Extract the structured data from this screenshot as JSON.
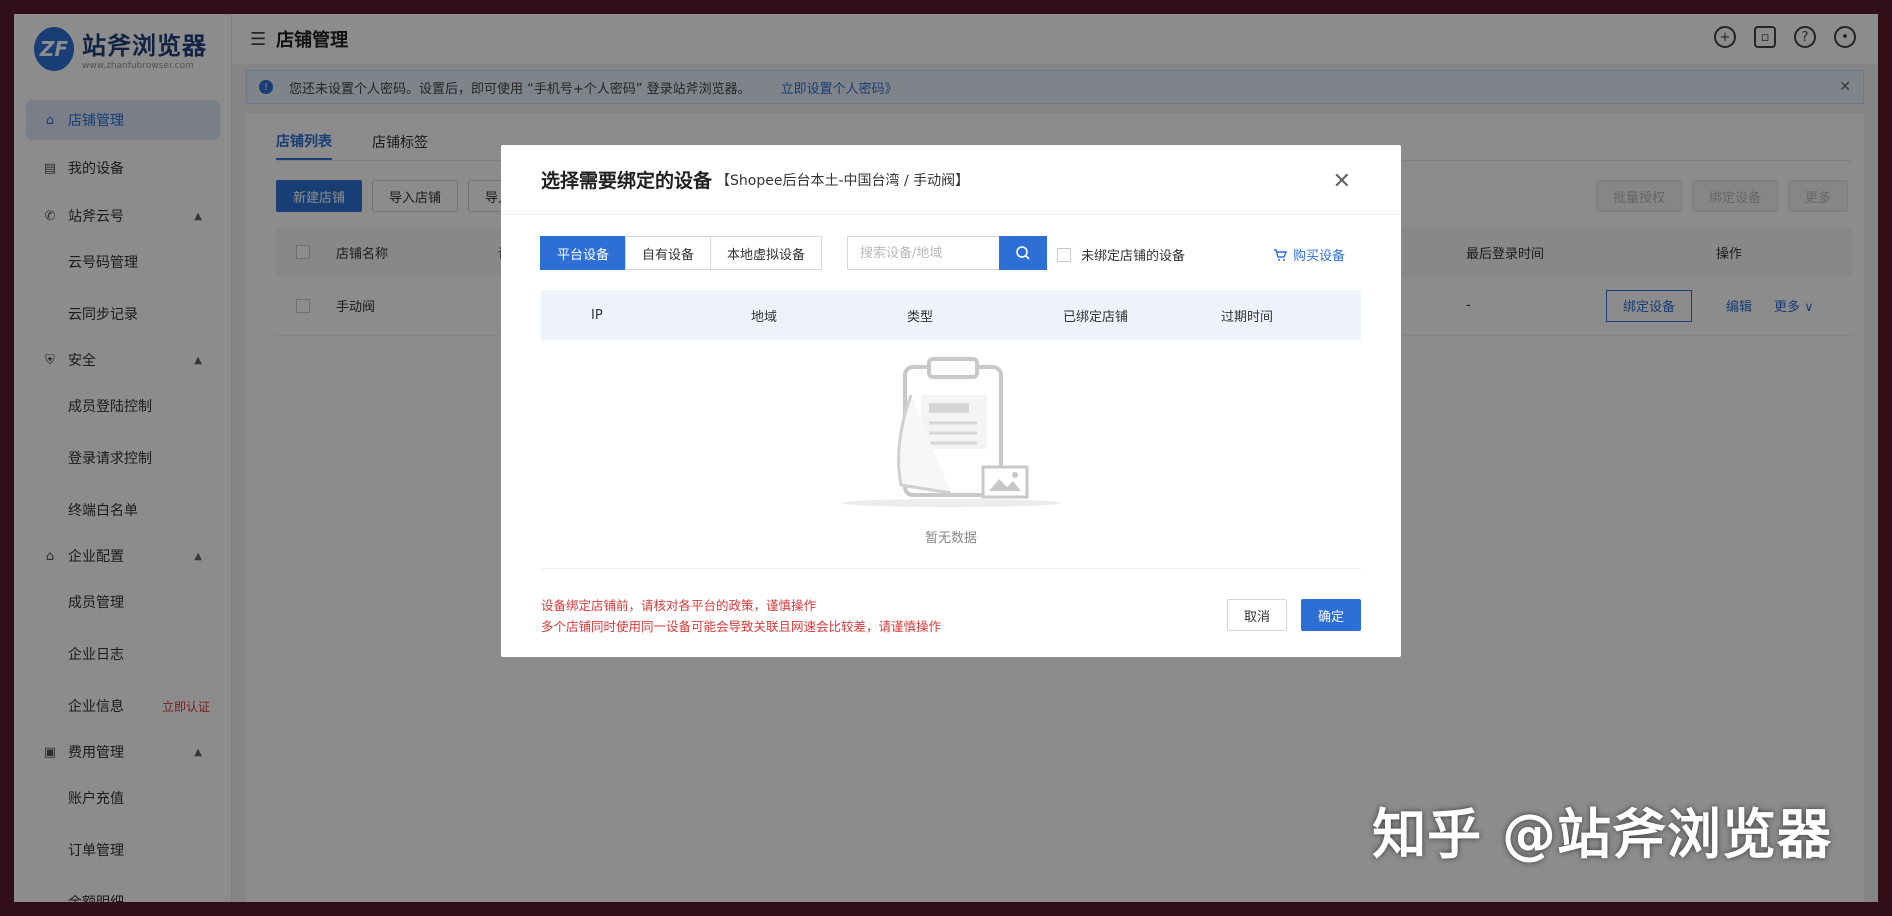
{
  "brand": {
    "name": "站斧浏览器",
    "url": "www.zhanfubrowser.com",
    "mark": "ZF",
    "accent": "#2e6fd6"
  },
  "sidebar": {
    "items": [
      {
        "label": "店铺管理",
        "icon": "home-icon",
        "active": true
      },
      {
        "label": "我的设备",
        "icon": "devices-icon"
      }
    ],
    "groups": [
      {
        "label": "站斧云号",
        "icon": "phone-icon",
        "subs": [
          {
            "label": "云号码管理"
          },
          {
            "label": "云同步记录"
          }
        ]
      },
      {
        "label": "安全",
        "icon": "shield-icon",
        "subs": [
          {
            "label": "成员登陆控制"
          },
          {
            "label": "登录请求控制"
          },
          {
            "label": "终端白名单"
          }
        ]
      },
      {
        "label": "企业配置",
        "icon": "bank-icon",
        "subs": [
          {
            "label": "成员管理"
          },
          {
            "label": "企业日志"
          },
          {
            "label": "企业信息",
            "tag": "立即认证"
          }
        ]
      },
      {
        "label": "费用管理",
        "icon": "wallet-icon",
        "subs": [
          {
            "label": "账户充值"
          },
          {
            "label": "订单管理"
          },
          {
            "label": "余额明细"
          }
        ]
      }
    ]
  },
  "topbar": {
    "title": "店铺管理"
  },
  "notice": {
    "text": "您还未设置个人密码。设置后，即可使用 “手机号+个人密码” 登录站斧浏览器。",
    "link": "立即设置个人密码》"
  },
  "tabs": [
    {
      "label": "店铺列表",
      "active": true
    },
    {
      "label": "店铺标签"
    }
  ],
  "actions": {
    "new_store": "新建店铺",
    "import_store": "导入店铺",
    "import_short": "导入",
    "bulk_auth": "批量授权",
    "bind_device": "绑定设备",
    "more": "更多"
  },
  "table": {
    "headers": {
      "name": "店铺名称",
      "device": "设",
      "last_login": "最后登录时间",
      "ops": "操作"
    },
    "row": {
      "name": "手动阀",
      "dash": "-",
      "last_login": "-",
      "bind": "绑定设备",
      "edit": "编辑",
      "more": "更多 ∨"
    }
  },
  "modal": {
    "title": "选择需要绑定的设备",
    "subtitle": "【Shopee后台本土-中国台湾 / 手动阀】",
    "segments": [
      {
        "label": "平台设备",
        "active": true
      },
      {
        "label": "自有设备"
      },
      {
        "label": "本地虚拟设备"
      }
    ],
    "search_placeholder": "搜索设备/地域",
    "filter_label": "未绑定店铺的设备",
    "buy_label": "购买设备",
    "columns": [
      "IP",
      "地域",
      "类型",
      "已绑定店铺",
      "过期时间"
    ],
    "empty_text": "暂无数据",
    "warning_line1": "设备绑定店铺前，请核对各平台的政策，谨慎操作",
    "warning_line2": "多个店铺同时使用同一设备可能会导致关联且网速会比较差，请谨慎操作",
    "cancel": "取消",
    "confirm": "确定"
  },
  "watermark": "知乎 @站斧浏览器"
}
